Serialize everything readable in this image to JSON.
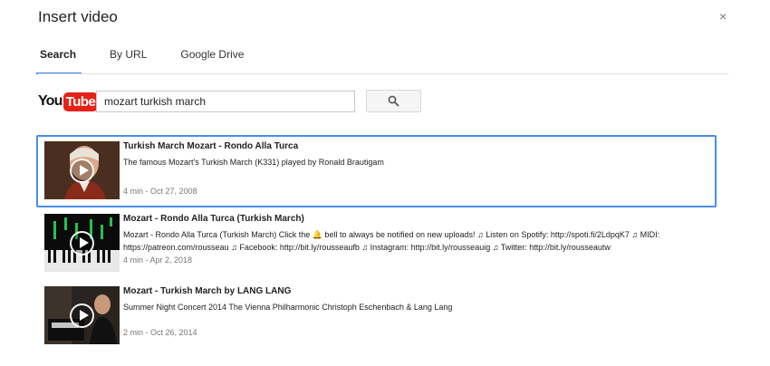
{
  "dialog": {
    "title": "Insert video",
    "close_label": "×"
  },
  "tabs": [
    {
      "label": "Search",
      "active": true
    },
    {
      "label": "By URL",
      "active": false
    },
    {
      "label": "Google Drive",
      "active": false
    }
  ],
  "logo": {
    "you": "You",
    "tube": "Tube"
  },
  "search": {
    "value": "mozart turkish march",
    "button_icon": "search-icon"
  },
  "colors": {
    "accent": "#4285f4",
    "selected_border": "#4a8fe8",
    "youtube_red": "#e62117"
  },
  "results": [
    {
      "title": "Turkish March Mozart - Rondo Alla Turca",
      "description": "The famous Mozart's Turkish March (K331) played by Ronald Brautigam",
      "meta": "4 min - Oct 27, 2008",
      "selected": true
    },
    {
      "title": "Mozart - Rondo Alla Turca (Turkish March)",
      "description": "Mozart - Rondo Alla Turca (Turkish March) Click the 🔔 bell to always be notified on new uploads! ♫ Listen on Spotify: http://spoti.fi/2LdpqK7 ♫ MIDI: https://patreon.com/rousseau ♫ Facebook: http://bit.ly/rousseaufb ♫ Instagram: http://bit.ly/rousseauig ♫ Twitter: http://bit.ly/rousseautw",
      "meta": "4 min - Apr 2, 2018",
      "selected": false
    },
    {
      "title": "Mozart - Turkish March by LANG LANG",
      "description": "Summer Night Concert 2014 The Vienna Philharmonic Christoph Eschenbach & Lang Lang",
      "meta": "2 min - Oct 26, 2014",
      "selected": false
    }
  ]
}
